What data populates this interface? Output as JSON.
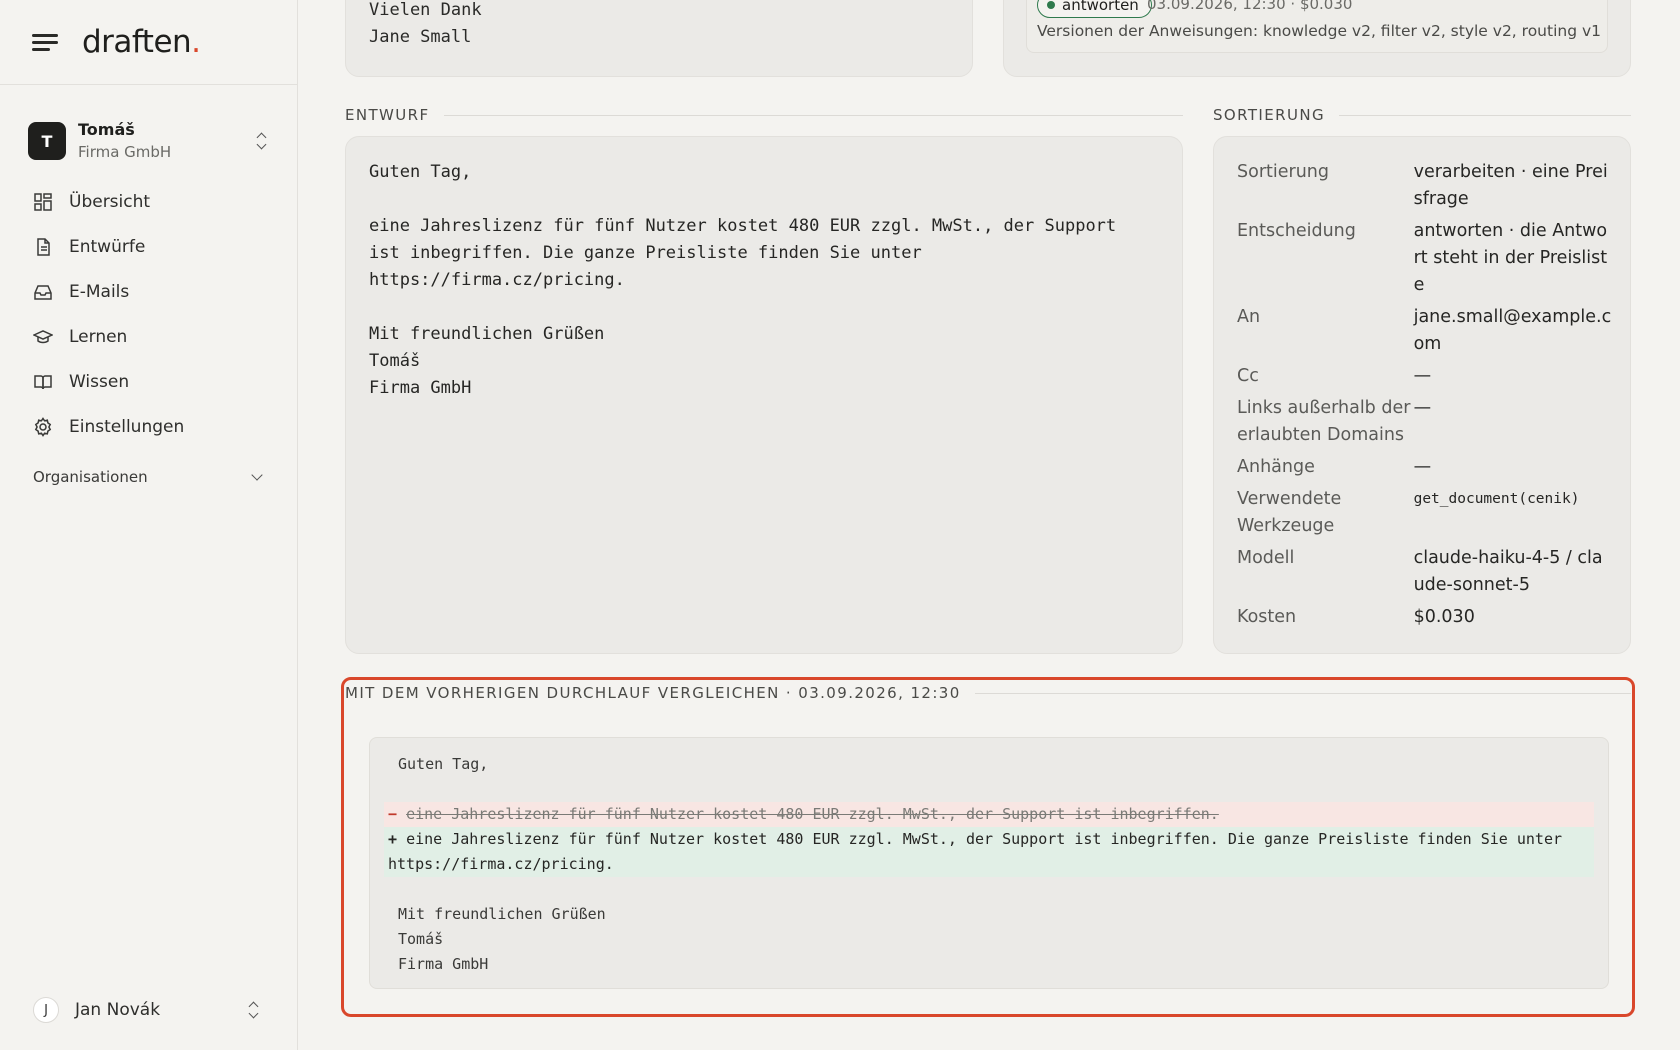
{
  "brand": {
    "name": "draften",
    "dot": "."
  },
  "account": {
    "initial": "T",
    "name": "Tomáš",
    "org": "Firma GmbH"
  },
  "nav": [
    {
      "label": "Übersicht",
      "icon": "dashboard-icon"
    },
    {
      "label": "Entwürfe",
      "icon": "document-icon"
    },
    {
      "label": "E-Mails",
      "icon": "inbox-icon"
    },
    {
      "label": "Lernen",
      "icon": "graduation-cap-icon"
    },
    {
      "label": "Wissen",
      "icon": "book-icon"
    },
    {
      "label": "Einstellungen",
      "icon": "gear-icon"
    }
  ],
  "orgs_label": "Organisationen",
  "user": {
    "initial": "J",
    "name": "Jan Novák"
  },
  "top_left_text": "Vielen Dank\nJane Small",
  "top_right": {
    "badge": "antworten",
    "meta": "03.09.2026, 12:30 · $0.030",
    "versions": "Versionen der Anweisungen: knowledge v2, filter v2, style v2, routing v1"
  },
  "draft": {
    "label": "ENTWURF",
    "text": "Guten Tag,\n\neine Jahreslizenz für fünf Nutzer kostet 480 EUR zzgl. MwSt., der Support\nist inbegriffen. Die ganze Preisliste finden Sie unter\nhttps://firma.cz/pricing.\n\nMit freundlichen Grüßen\nTomáš\nFirma GmbH"
  },
  "sorting": {
    "label": "SORTIERUNG",
    "rows": [
      {
        "key": "Sortierung",
        "value": "verarbeiten · eine Preisfrage"
      },
      {
        "key": "Entscheidung",
        "value": "antworten · die Antwort steht in der Preisliste"
      },
      {
        "key": "An",
        "value": "jane.small@example.com"
      },
      {
        "key": "Cc",
        "value": "—"
      },
      {
        "key": "Links außerhalb der erlaubten Domains",
        "value": "—"
      },
      {
        "key": "Anhänge",
        "value": "—"
      },
      {
        "key": "Verwendete Werkzeuge",
        "value": "get_document(cenik)",
        "code": true
      },
      {
        "key": "Modell",
        "value": "claude-haiku-4-5 / claude-sonnet-5"
      },
      {
        "key": "Kosten",
        "value": "$0.030"
      }
    ]
  },
  "compare": {
    "label": "MIT DEM VORHERIGEN DURCHLAUF VERGLEICHEN · 03.09.2026, 12:30",
    "lines": [
      {
        "type": "ctx",
        "text": "Guten Tag,"
      },
      {
        "type": "ctx",
        "text": " "
      },
      {
        "type": "del",
        "sign": "−",
        "text": "eine Jahreslizenz für fünf Nutzer kostet 480 EUR zzgl. MwSt., der Support ist inbegriffen."
      },
      {
        "type": "add",
        "sign": "+",
        "text": "eine Jahreslizenz für fünf Nutzer kostet 480 EUR zzgl. MwSt., der Support ist inbegriffen. Die ganze Preisliste finden Sie unter https://firma.cz/pricing."
      },
      {
        "type": "ctx",
        "text": " "
      },
      {
        "type": "ctx",
        "text": "Mit freundlichen Grüßen"
      },
      {
        "type": "ctx",
        "text": "Tomáš"
      },
      {
        "type": "ctx",
        "text": "Firma GmbH"
      }
    ]
  }
}
